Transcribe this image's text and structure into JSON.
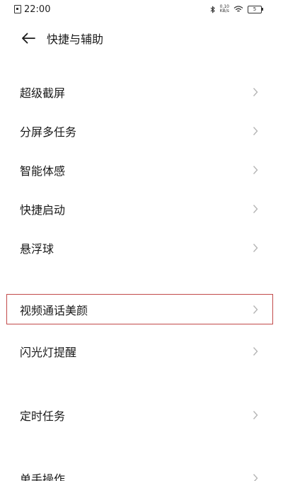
{
  "status_bar": {
    "time": "22:00",
    "net_speed_value": "0.10",
    "net_speed_unit": "KB/s",
    "battery": "5"
  },
  "header": {
    "title": "快捷与辅助",
    "back_icon": "arrow-left-icon"
  },
  "menu_items": [
    {
      "label": "超级截屏"
    },
    {
      "label": "分屏多任务"
    },
    {
      "label": "智能体感"
    },
    {
      "label": "快捷启动"
    },
    {
      "label": "悬浮球"
    },
    {
      "label": "视频通话美颜"
    },
    {
      "label": "闪光灯提醒"
    },
    {
      "label": "定时任务"
    },
    {
      "label": "单手操作"
    }
  ],
  "colors": {
    "highlight_border": "#c24a4a",
    "chevron": "#b5b5b5",
    "text": "#1a1a1a"
  }
}
